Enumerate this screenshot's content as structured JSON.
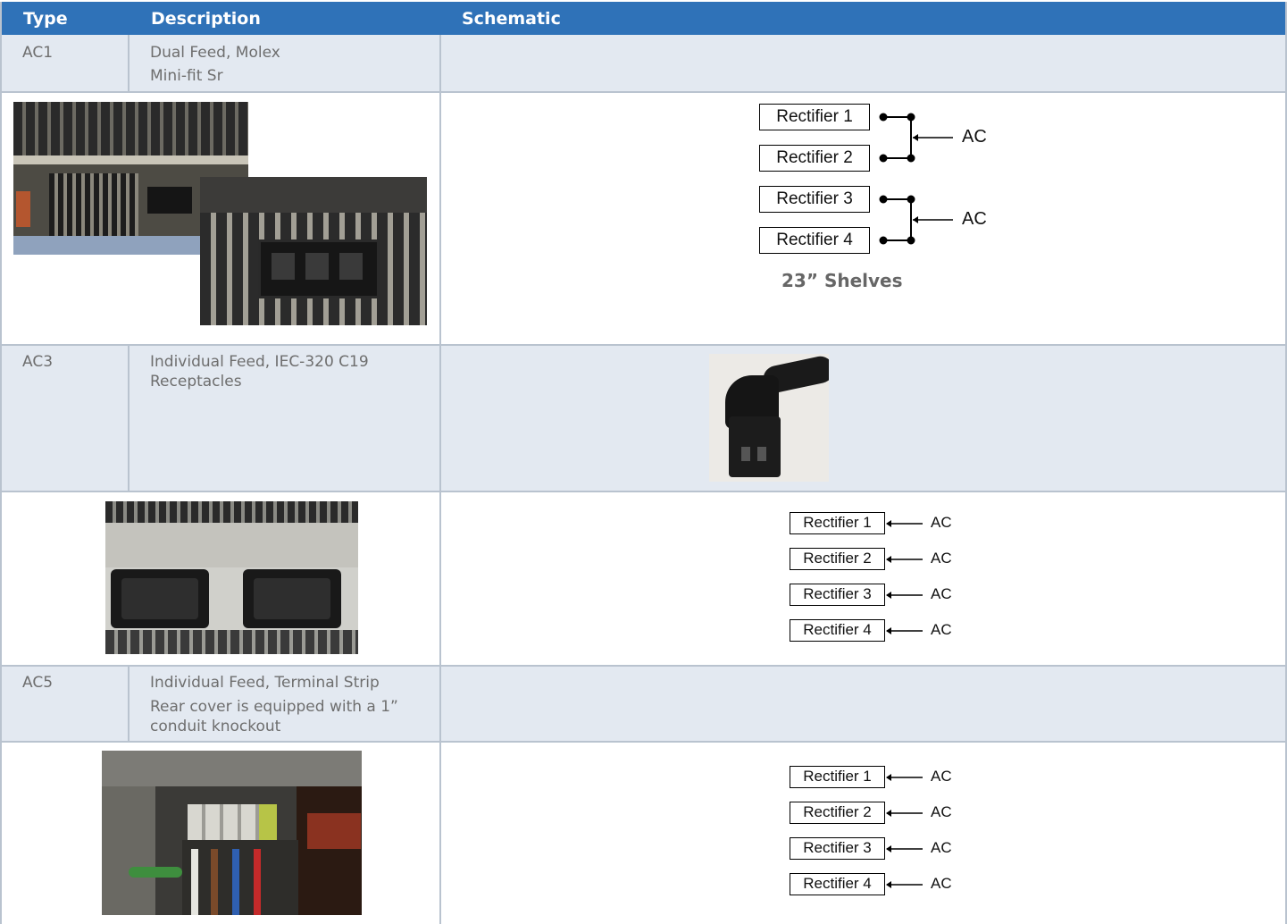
{
  "header": {
    "type": "Type",
    "description": "Description",
    "schematic": "Schematic"
  },
  "rows": [
    {
      "type": "AC1",
      "desc1": "Dual Feed, Molex",
      "desc2": "Mini-fit Sr"
    },
    {
      "type": "AC3",
      "desc1": "Individual Feed, IEC-320 C19",
      "desc2": "Receptacles"
    },
    {
      "type": "AC5",
      "desc1": "Individual Feed, Terminal Strip",
      "desc2": "Rear cover is equipped with a 1”",
      "desc3": "conduit knockout"
    }
  ],
  "schematic1": {
    "rectifiers": [
      "Rectifier 1",
      "Rectifier 2",
      "Rectifier 3",
      "Rectifier 4"
    ],
    "ac": [
      "AC",
      "AC"
    ],
    "caption": "23” Shelves"
  },
  "schematic2": {
    "rectifiers": [
      "Rectifier 1",
      "Rectifier 2",
      "Rectifier 3",
      "Rectifier 4"
    ],
    "ac": [
      "AC",
      "AC",
      "AC",
      "AC"
    ]
  },
  "schematic3": {
    "rectifiers": [
      "Rectifier 1",
      "Rectifier 2",
      "Rectifier 3",
      "Rectifier 4"
    ],
    "ac": [
      "AC",
      "AC",
      "AC",
      "AC"
    ]
  },
  "photos": {
    "p1": "molex-connector-photo",
    "p2": "iec-c19-plug-photo",
    "p3": "c19-receptacles-photo",
    "p4": "terminal-strip-photo"
  }
}
